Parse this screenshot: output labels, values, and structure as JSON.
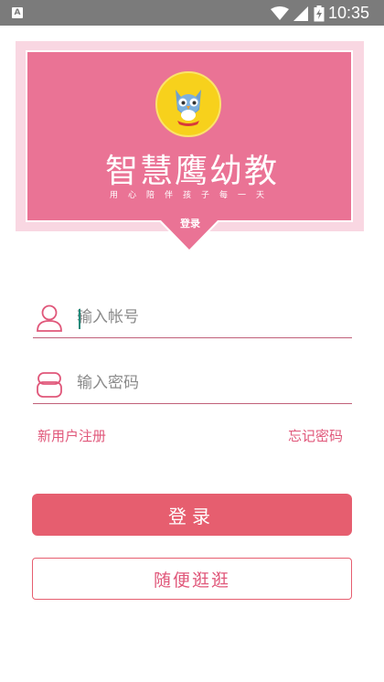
{
  "status_bar": {
    "time": "10:35",
    "app_icon_glyph": "A"
  },
  "banner": {
    "brand_title": "智慧鹰幼教",
    "slogan": "用心陪伴孩子每一天",
    "login_tag": "登录",
    "logo_icon": "owl-mascot-icon"
  },
  "form": {
    "account_placeholder": "输入帐号",
    "password_placeholder": "输入密码",
    "account_value": "",
    "password_value": ""
  },
  "links": {
    "register": "新用户注册",
    "forgot_password": "忘记密码"
  },
  "buttons": {
    "login": "登录",
    "browse": "随便逛逛"
  },
  "colors": {
    "accent": "#e65e6f",
    "banner_pink": "#ea7395",
    "banner_frame": "#f9d7e2",
    "status_bar": "#7b7b7b"
  }
}
